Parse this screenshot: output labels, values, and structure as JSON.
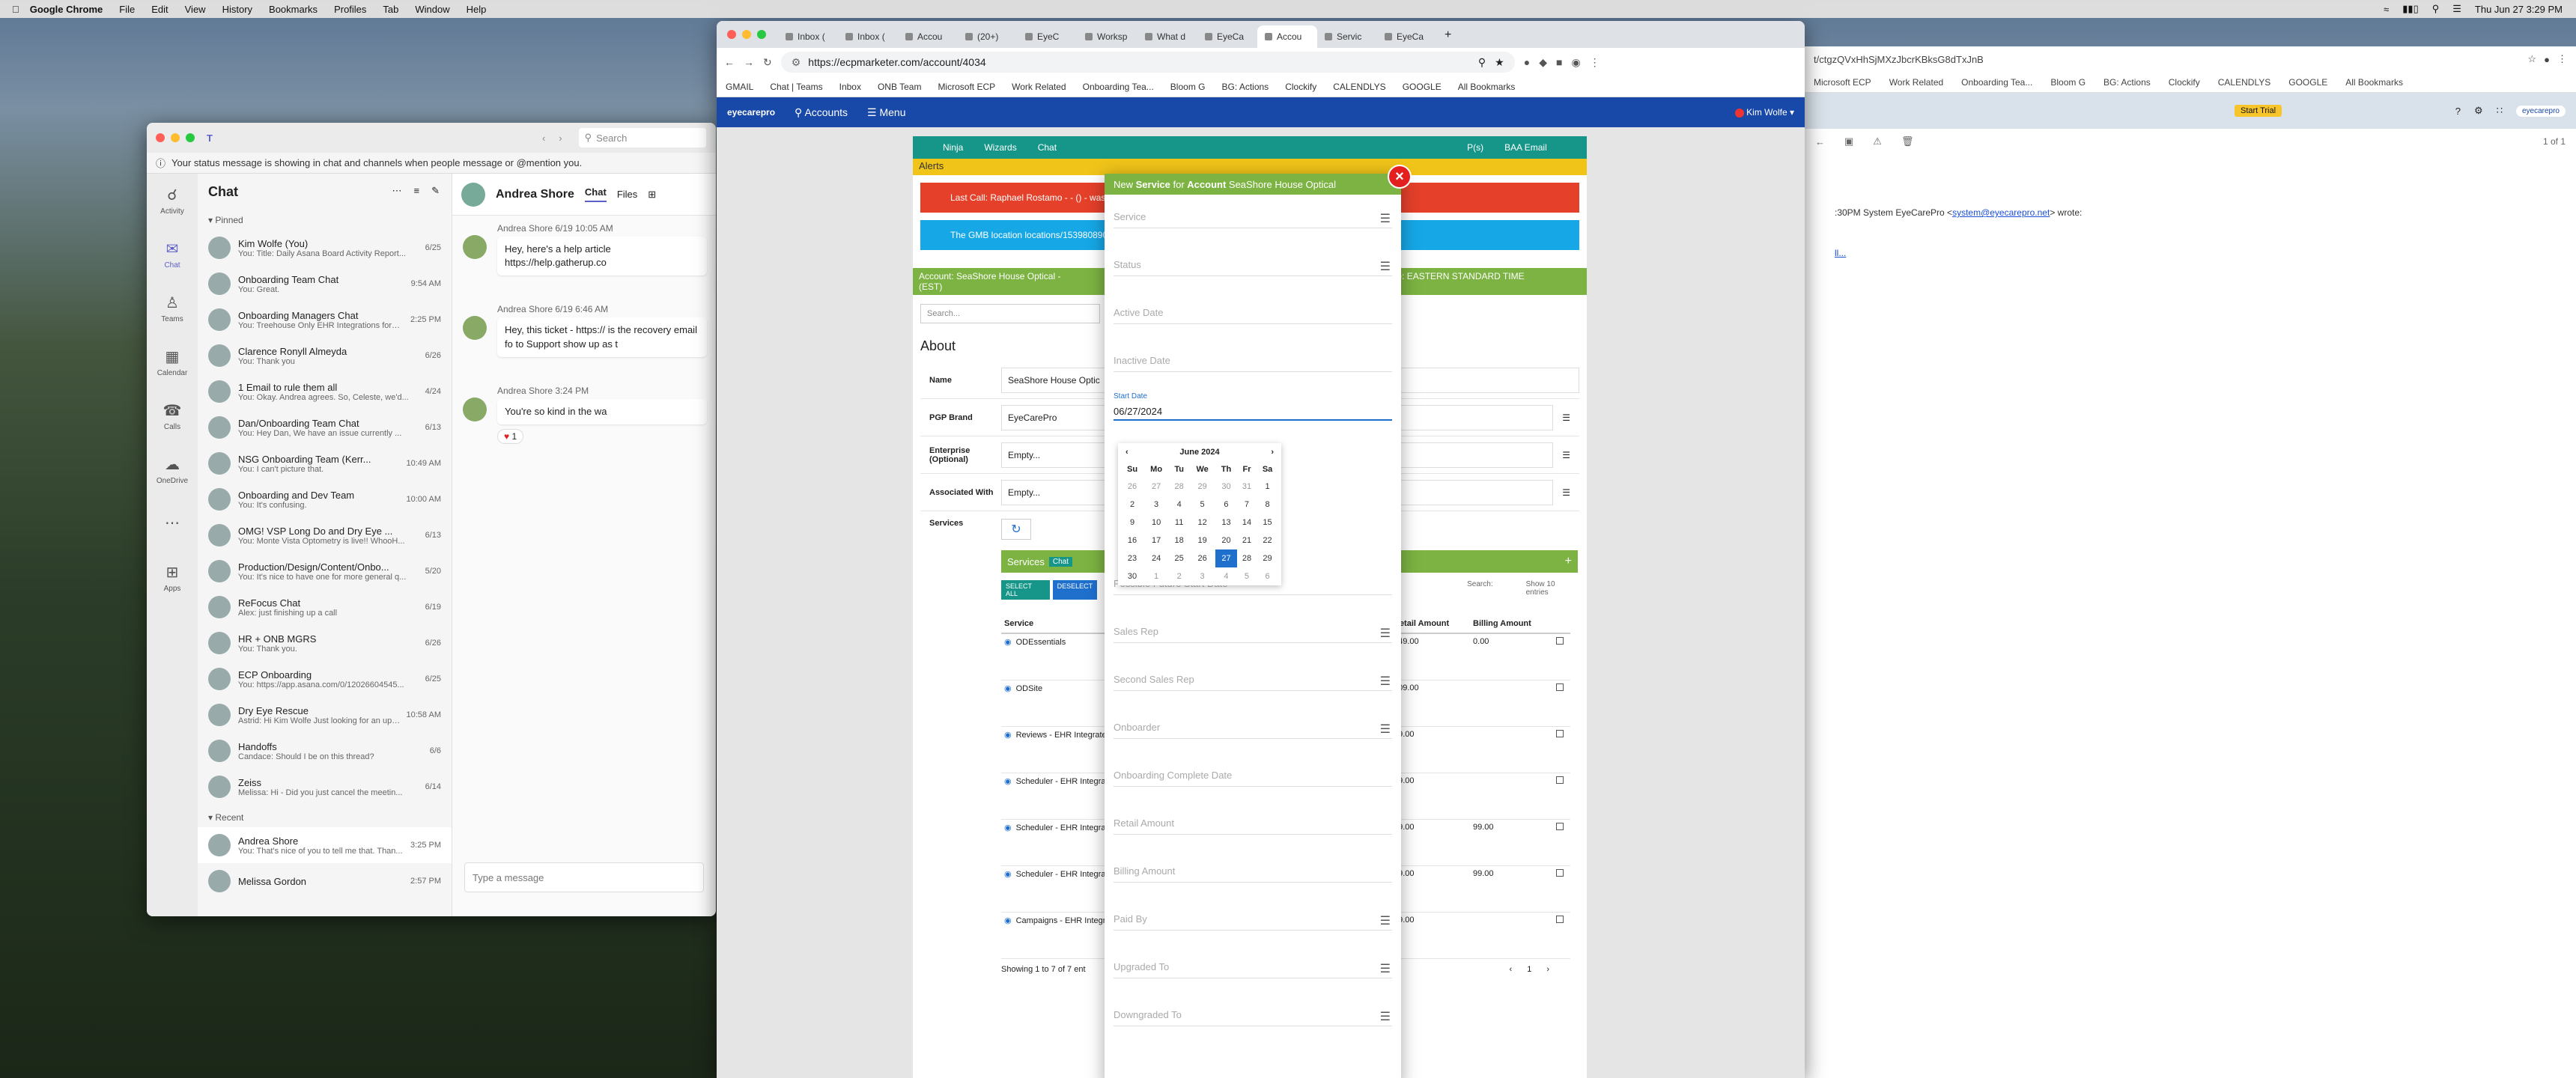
{
  "menubar": {
    "app": "Google Chrome",
    "items": [
      "File",
      "Edit",
      "View",
      "History",
      "Bookmarks",
      "Profiles",
      "Tab",
      "Window",
      "Help"
    ],
    "clock": "Thu Jun 27  3:29 PM"
  },
  "teams": {
    "search_placeholder": "Search",
    "status_msg": "Your status message is showing in chat and channels when people message or @mention you.",
    "rail": [
      "Activity",
      "Chat",
      "Teams",
      "Calendar",
      "Calls",
      "OneDrive",
      "Apps"
    ],
    "chat_title": "Chat",
    "pinned_label": "Pinned",
    "recent_label": "Recent",
    "pinned": [
      {
        "name": "Kim Wolfe (You)",
        "preview": "You: Title: Daily Asana Board Activity Report...",
        "time": "6/25"
      },
      {
        "name": "Onboarding Team Chat",
        "preview": "You: Great.",
        "time": "9:54 AM"
      },
      {
        "name": "Onboarding Managers Chat",
        "preview": "You: Treehouse Only EHR Integrations form:...",
        "time": "2:25 PM"
      },
      {
        "name": "Clarence Ronyll Almeyda",
        "preview": "You: Thank you",
        "time": "6/26"
      },
      {
        "name": "1 Email to rule them all",
        "preview": "You: Okay. Andrea agrees. So, Celeste, we'd...",
        "time": "4/24"
      },
      {
        "name": "Dan/Onboarding Team Chat",
        "preview": "You: Hey Dan,    We have an issue currently ...",
        "time": "6/13"
      },
      {
        "name": "NSG Onboarding Team (Kerr...",
        "preview": "You: I can't picture that.",
        "time": "10:49 AM"
      },
      {
        "name": "Onboarding and Dev Team",
        "preview": "You: It's confusing.",
        "time": "10:00 AM"
      },
      {
        "name": "OMG! VSP Long Do and Dry Eye ...",
        "preview": "You: Monte Vista Optometry is live!! WhooH...",
        "time": "6/13"
      },
      {
        "name": "Production/Design/Content/Onbo...",
        "preview": "You: It's nice to have one for more general q...",
        "time": "5/20"
      },
      {
        "name": "ReFocus Chat",
        "preview": "Alex: just finishing up a call",
        "time": "6/19"
      },
      {
        "name": "HR + ONB MGRS",
        "preview": "You: Thank you.",
        "time": "6/26"
      },
      {
        "name": "ECP Onboarding",
        "preview": "You: https://app.asana.com/0/12026604545...",
        "time": "6/25"
      },
      {
        "name": "Dry Eye Rescue",
        "preview": "Astrid: Hi Kim Wolfe Just looking for an upd...",
        "time": "10:58 AM"
      },
      {
        "name": "Handoffs",
        "preview": "Candace: Should I be on this thread?",
        "time": "6/6"
      },
      {
        "name": "Zeiss",
        "preview": "Melissa: Hi - Did you just cancel the meetin...",
        "time": "6/14"
      }
    ],
    "recent": [
      {
        "name": "Andrea Shore",
        "preview": "You: That's nice of you to tell me that. Than...",
        "time": "3:25 PM"
      },
      {
        "name": "Melissa Gordon",
        "preview": "",
        "time": "2:57 PM"
      }
    ],
    "conv": {
      "name": "Andrea Shore",
      "tabs": [
        "Chat",
        "Files"
      ],
      "messages": [
        {
          "meta": "Andrea Shore  6/19 10:05 AM",
          "text": "Hey, here's a help article https://help.gatherup.co"
        },
        {
          "meta": "Andrea Shore  6/19 6:46 AM",
          "text": "Hey, this ticket - https:// is the recovery email fo to Support show up as t"
        },
        {
          "meta": "Andrea Shore  3:24 PM",
          "text": "You're so kind in the wa"
        }
      ],
      "reaction": "1",
      "compose_placeholder": "Type a message"
    }
  },
  "chrome": {
    "tabs": [
      "Inbox (",
      "Inbox (",
      "Accou",
      "(20+)",
      "EyeC",
      "Worksp",
      "What d",
      "EyeCa",
      "Accou",
      "Servic",
      "EyeCa"
    ],
    "active_tab_index": 8,
    "url": "https://ecpmarketer.com/account/4034",
    "bookmarks": [
      "GMAIL",
      "Chat | Teams",
      "Inbox",
      "ONB Team",
      "Microsoft ECP",
      "Work Related",
      "Onboarding Tea...",
      "Bloom G",
      "BG: Actions",
      "Clockify",
      "CALENDLYS",
      "GOOGLE",
      "All Bookmarks"
    ],
    "app_nav": {
      "brand": "eyecarepro",
      "accounts": "Accounts",
      "menu": "Menu",
      "user": "Kim Wolfe"
    }
  },
  "account": {
    "toolbar": [
      "Ninja",
      "Wizards",
      "Chat",
      "P(s)",
      "BAA Email"
    ],
    "alerts_label": "Alerts",
    "alert_red": "Last Call: Raphael Rostamo - - () - was ...",
    "alert_blue": "The GMB location locations/1539808905 ... business dashboard",
    "account_bar_left": "Account: SeaShore House Optical -",
    "account_bar_tz": "Timezone: EASTERN STANDARD TIME",
    "account_bar_est": "(EST)",
    "search_placeholder": "Search...",
    "about_title": "About",
    "rows": [
      {
        "label": "Name",
        "value": "SeaShore House Optic"
      },
      {
        "label": "PGP Brand",
        "value": "EyeCarePro"
      },
      {
        "label": "Enterprise (Optional)",
        "value": "Empty..."
      },
      {
        "label": "Associated With",
        "value": "Empty..."
      }
    ],
    "services_label": "Services",
    "services_header": "Services",
    "chat_badge": "Chat",
    "select_all": "SELECT ALL",
    "deselect": "DESELECT",
    "search_label": "Search:",
    "show_label": "Show",
    "show_val": "10",
    "entries_label": "entries",
    "cols": [
      "Service",
      "Retail Amount",
      "Billing Amount"
    ],
    "services": [
      {
        "name": "ODEssentials",
        "retail": "349.00",
        "billing": "0.00"
      },
      {
        "name": "ODSite",
        "retail": "109.00",
        "billing": ""
      },
      {
        "name": "Reviews - EHR Integrated",
        "retail": "49.00",
        "billing": ""
      },
      {
        "name": "Scheduler - EHR Integrated",
        "retail": "99.00",
        "billing": ""
      },
      {
        "name": "Scheduler - EHR Integrated",
        "retail": "99.00",
        "billing": "99.00"
      },
      {
        "name": "Scheduler - EHR Integrated",
        "retail": "99.00",
        "billing": "99.00"
      },
      {
        "name": "Campaigns - EHR Integrated",
        "retail": "49.00",
        "billing": ""
      }
    ],
    "showing": "Showing 1 to 7 of 7 ent",
    "page_num": "1"
  },
  "modal": {
    "title_prefix": "New ",
    "title_bold1": "Service",
    "title_mid": " for ",
    "title_bold2": "Account",
    "title_name": " SeaShore House Optical",
    "fields": [
      "Service",
      "Status",
      "Active Date",
      "Inactive Date"
    ],
    "start_label": "Start Date",
    "start_value": "06/27/2024",
    "fields2": [
      "Possible Future Start Date",
      "Sales Rep",
      "Second Sales Rep",
      "Onboarder",
      "Onboarding Complete Date",
      "Retail Amount",
      "Billing Amount",
      "Paid By",
      "Upgraded To",
      "Downgraded To"
    ],
    "close": "×"
  },
  "calendar": {
    "month": "June 2024",
    "prev": "‹",
    "next": "›",
    "dow": [
      "Su",
      "Mo",
      "Tu",
      "We",
      "Th",
      "Fr",
      "Sa"
    ],
    "weeks": [
      [
        "26",
        "27",
        "28",
        "29",
        "30",
        "31",
        "1"
      ],
      [
        "2",
        "3",
        "4",
        "5",
        "6",
        "7",
        "8"
      ],
      [
        "9",
        "10",
        "11",
        "12",
        "13",
        "14",
        "15"
      ],
      [
        "16",
        "17",
        "18",
        "19",
        "20",
        "21",
        "22"
      ],
      [
        "23",
        "24",
        "25",
        "26",
        "27",
        "28",
        "29"
      ],
      [
        "30",
        "1",
        "2",
        "3",
        "4",
        "5",
        "6"
      ]
    ],
    "selected": "27"
  },
  "mail": {
    "url": "t/ctgzQVxHhSjMXzJbcrKBksG8dTxJnB",
    "bookmarks": [
      "Microsoft ECP",
      "Work Related",
      "Onboarding Tea...",
      "Bloom G",
      "BG: Actions",
      "Clockify",
      "CALENDLYS",
      "GOOGLE",
      "All Bookmarks"
    ],
    "start_trial": "Start Trial",
    "pagination": "1 of 1",
    "wrote": ":30PM System EyeCarePro <",
    "wrote_email": "system@eyecarepro.net",
    "wrote_end": "> wrote:",
    "trimmed": "ll..."
  },
  "colors": {
    "teams_accent": "#5b5fc7",
    "nav_blue": "#1848a8",
    "teal": "#159688",
    "green": "#7cb342",
    "alert_red": "#e4402a",
    "alert_blue": "#16a7e6",
    "highlight_orange": "#ff6a3a",
    "highlight_yellow": "#f7f03a"
  }
}
